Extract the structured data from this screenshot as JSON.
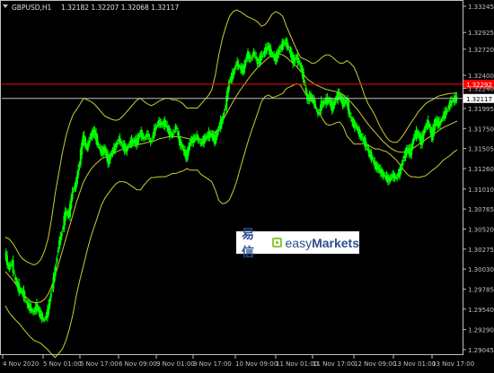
{
  "header": {
    "symbol_timeframe": "GBPUSD,H1",
    "ohlc": "1.32182 1.32207 1.32068 1.32117"
  },
  "watermark": {
    "brand_cjk": "易信",
    "brand_easy": "easy",
    "brand_markets": "Markets"
  },
  "colors": {
    "background": "#000000",
    "axis": "#c0c0c0",
    "candle": "#00ff00",
    "bands": "#cccc33",
    "alert_line": "#ff0000",
    "bid_line": "#c0c0c0",
    "alert_label_bg": "#ff0000",
    "bid_label_bg": "#ffffff"
  },
  "chart_data": {
    "type": "candlestick",
    "indicator": "Bollinger Bands",
    "ylim": [
      1.29,
      1.333
    ],
    "y_ticks": [
      1.33245,
      1.32925,
      1.3272,
      1.324,
      1.3224,
      1.31995,
      1.3175,
      1.31505,
      1.3126,
      1.3101,
      1.30765,
      1.3052,
      1.30275,
      1.3003,
      1.29785,
      1.2954,
      1.2929,
      1.29045
    ],
    "horizontal_lines": [
      {
        "name": "alert",
        "value": 1.32292,
        "label": "1.32292"
      },
      {
        "name": "bid",
        "value": 1.32117,
        "label": "1.32117"
      }
    ],
    "x_ticks": [
      "4 Nov 2020",
      "5 Nov 01:00",
      "5 Nov 17:00",
      "6 Nov 09:00",
      "9 Nov 01:00",
      "9 Nov 17:00",
      "10 Nov 09:00",
      "11 Nov 01:00",
      "11 Nov 17:00",
      "12 Nov 09:00",
      "13 Nov 01:00",
      "13 Nov 17:00"
    ],
    "close_path": [
      1.3022,
      1.3005,
      1.301,
      1.2988,
      1.2978,
      1.2975,
      1.2962,
      1.2955,
      1.295,
      1.2958,
      1.2946,
      1.294,
      1.295,
      1.2975,
      1.2998,
      1.303,
      1.3048,
      1.3072,
      1.307,
      1.3098,
      1.3108,
      1.3135,
      1.3165,
      1.315,
      1.3165,
      1.3172,
      1.3158,
      1.3145,
      1.315,
      1.3135,
      1.3145,
      1.3152,
      1.3162,
      1.3155,
      1.3148,
      1.3156,
      1.316,
      1.3158,
      1.317,
      1.3162,
      1.3168,
      1.3158,
      1.3172,
      1.3182,
      1.318,
      1.3182,
      1.3172,
      1.3165,
      1.3178,
      1.316,
      1.315,
      1.314,
      1.3158,
      1.3162,
      1.3165,
      1.3155,
      1.3162,
      1.3167,
      1.3168,
      1.316,
      1.3175,
      1.3185,
      1.3202,
      1.3232,
      1.324,
      1.3255,
      1.325,
      1.3245,
      1.3265,
      1.326,
      1.3268,
      1.3255,
      1.3262,
      1.327,
      1.3275,
      1.3265,
      1.326,
      1.327,
      1.3278,
      1.328,
      1.327,
      1.3258,
      1.3262,
      1.3252,
      1.3235,
      1.321,
      1.3215,
      1.3205,
      1.3192,
      1.3205,
      1.3208,
      1.321,
      1.32,
      1.3212,
      1.3216,
      1.3205,
      1.321,
      1.319,
      1.318,
      1.3175,
      1.3165,
      1.316,
      1.3148,
      1.314,
      1.313,
      1.3126,
      1.312,
      1.3115,
      1.3112,
      1.3118,
      1.3114,
      1.3122,
      1.3138,
      1.315,
      1.3145,
      1.3165,
      1.317,
      1.3158,
      1.3175,
      1.3182,
      1.3165,
      1.3185,
      1.318,
      1.3188,
      1.3195,
      1.3205,
      1.321,
      1.3212
    ],
    "upper_band": [
      1.3042,
      1.304,
      1.3035,
      1.3028,
      1.302,
      1.3015,
      1.3012,
      1.301,
      1.3008,
      1.301,
      1.3015,
      1.3025,
      1.304,
      1.3065,
      1.3095,
      1.312,
      1.3145,
      1.3165,
      1.318,
      1.3192,
      1.3198,
      1.3205,
      1.3212,
      1.321,
      1.3208,
      1.3205,
      1.32,
      1.3195,
      1.319,
      1.3188,
      1.3186,
      1.3185,
      1.3186,
      1.319,
      1.3195,
      1.32,
      1.3205,
      1.321,
      1.3212,
      1.3208,
      1.3205,
      1.3203,
      1.3205,
      1.3208,
      1.321,
      1.3212,
      1.3212,
      1.321,
      1.321,
      1.3208,
      1.3205,
      1.32,
      1.32,
      1.32,
      1.32,
      1.3205,
      1.321,
      1.3215,
      1.3222,
      1.324,
      1.3265,
      1.3285,
      1.33,
      1.3312,
      1.3318,
      1.332,
      1.3318,
      1.3315,
      1.3312,
      1.331,
      1.3308,
      1.3305,
      1.33,
      1.3302,
      1.3308,
      1.3315,
      1.3318,
      1.3316,
      1.3312,
      1.33,
      1.329,
      1.328,
      1.327,
      1.3262,
      1.326,
      1.3258,
      1.3255,
      1.3255,
      1.3258,
      1.3262,
      1.3265,
      1.3265,
      1.3262,
      1.3258,
      1.3255,
      1.3255,
      1.3258,
      1.3255,
      1.325,
      1.324,
      1.3228,
      1.3215,
      1.3205,
      1.3198,
      1.319,
      1.318,
      1.3172,
      1.3165,
      1.316,
      1.3158,
      1.3158,
      1.3162,
      1.3168,
      1.3175,
      1.3182,
      1.3188,
      1.3195,
      1.32,
      1.3205,
      1.3208,
      1.321,
      1.3213,
      1.3215,
      1.3216,
      1.3217,
      1.3218,
      1.3218,
      1.3219
    ],
    "middle_band": [
      1.3,
      1.2995,
      1.299,
      1.2984,
      1.2978,
      1.2972,
      1.2968,
      1.2964,
      1.2962,
      1.2962,
      1.2963,
      1.2966,
      1.2972,
      1.2982,
      1.2995,
      1.301,
      1.3025,
      1.304,
      1.3055,
      1.307,
      1.3085,
      1.3098,
      1.311,
      1.3118,
      1.3125,
      1.313,
      1.3134,
      1.3138,
      1.314,
      1.3142,
      1.3144,
      1.3146,
      1.3148,
      1.315,
      1.3152,
      1.3153,
      1.3154,
      1.3155,
      1.3156,
      1.3157,
      1.3158,
      1.3159,
      1.316,
      1.3162,
      1.3163,
      1.3164,
      1.3165,
      1.3165,
      1.3165,
      1.3165,
      1.3164,
      1.3163,
      1.3162,
      1.3162,
      1.3162,
      1.3162,
      1.3163,
      1.3164,
      1.3166,
      1.317,
      1.3176,
      1.3184,
      1.3192,
      1.32,
      1.3208,
      1.3215,
      1.3222,
      1.3228,
      1.3234,
      1.324,
      1.3245,
      1.325,
      1.3254,
      1.3258,
      1.3262,
      1.3264,
      1.3266,
      1.3266,
      1.3265,
      1.3262,
      1.3258,
      1.3254,
      1.325,
      1.3245,
      1.324,
      1.3235,
      1.3232,
      1.3229,
      1.3227,
      1.3225,
      1.3223,
      1.3222,
      1.3221,
      1.322,
      1.3219,
      1.3216,
      1.3212,
      1.3208,
      1.3203,
      1.3198,
      1.3192,
      1.3186,
      1.318,
      1.3175,
      1.317,
      1.3165,
      1.316,
      1.3156,
      1.3152,
      1.3149,
      1.3147,
      1.3146,
      1.3146,
      1.3147,
      1.3149,
      1.3152,
      1.3155,
      1.3158,
      1.3161,
      1.3164,
      1.3167,
      1.317,
      1.3173,
      1.3176,
      1.3178,
      1.318,
      1.3182,
      1.3184
    ],
    "lower_band": [
      1.2958,
      1.295,
      1.2945,
      1.294,
      1.2936,
      1.293,
      1.2925,
      1.292,
      1.2916,
      1.2914,
      1.2912,
      1.2908,
      1.2904,
      1.2899,
      1.2895,
      1.29,
      1.2905,
      1.2915,
      1.293,
      1.2948,
      1.2972,
      1.2991,
      1.3008,
      1.3026,
      1.3042,
      1.3055,
      1.3068,
      1.3081,
      1.309,
      1.3096,
      1.3102,
      1.3107,
      1.311,
      1.311,
      1.3109,
      1.3106,
      1.3103,
      1.31,
      1.31,
      1.3106,
      1.3111,
      1.3115,
      1.3115,
      1.3116,
      1.3116,
      1.3116,
      1.3118,
      1.312,
      1.312,
      1.3122,
      1.3123,
      1.3126,
      1.3124,
      1.3124,
      1.3124,
      1.3119,
      1.3116,
      1.3113,
      1.311,
      1.31,
      1.3087,
      1.3083,
      1.3084,
      1.3088,
      1.3098,
      1.311,
      1.3126,
      1.3141,
      1.3156,
      1.317,
      1.3182,
      1.3195,
      1.3208,
      1.3214,
      1.3216,
      1.3213,
      1.3214,
      1.3216,
      1.3218,
      1.3224,
      1.3226,
      1.3228,
      1.323,
      1.3228,
      1.322,
      1.3212,
      1.3209,
      1.3203,
      1.3196,
      1.3188,
      1.3181,
      1.3179,
      1.318,
      1.3182,
      1.3183,
      1.3177,
      1.3166,
      1.3161,
      1.3156,
      1.3156,
      1.3156,
      1.3157,
      1.3155,
      1.3152,
      1.315,
      1.315,
      1.3148,
      1.3147,
      1.3144,
      1.314,
      1.3136,
      1.313,
      1.3124,
      1.3119,
      1.3116,
      1.3116,
      1.3115,
      1.3116,
      1.3117,
      1.312,
      1.3124,
      1.3127,
      1.3131,
      1.3136,
      1.3139,
      1.3142,
      1.3146,
      1.3149
    ]
  }
}
